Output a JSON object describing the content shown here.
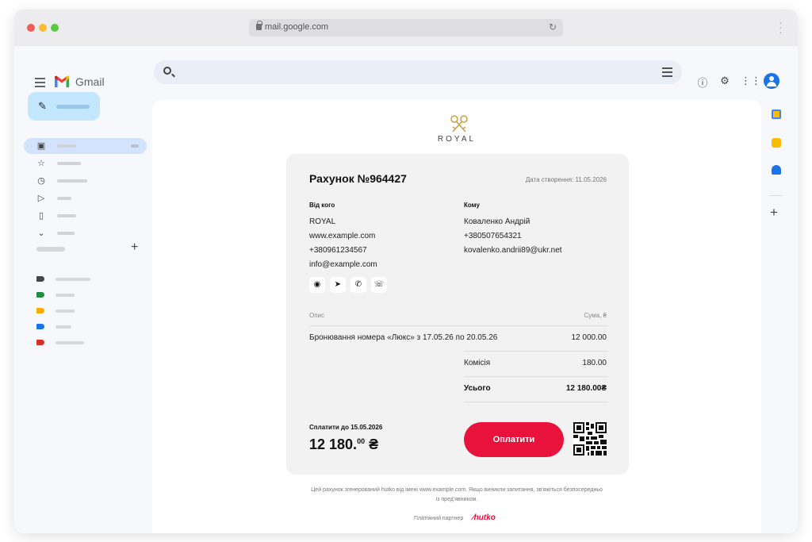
{
  "browser": {
    "url": "mail.google.com"
  },
  "gmail": {
    "app_name": "Gmail"
  },
  "colors": {
    "accent": "#e8123c",
    "compose": "#c2e7ff",
    "nav_active": "#d3e3fd",
    "label_tags": [
      "#444746",
      "#1e8e3e",
      "#f9ab00",
      "#1a73e8",
      "#d93025"
    ]
  },
  "icons": {
    "nav": [
      "inbox-icon",
      "star-icon",
      "clock-icon",
      "send-icon",
      "file-icon",
      "chevron-down-icon"
    ],
    "top": [
      "help-icon",
      "gear-icon",
      "apps-icon"
    ],
    "social": [
      "messenger-icon",
      "telegram-icon",
      "whatsapp-icon",
      "viber-icon"
    ]
  },
  "email": {
    "brand": "ROYAL",
    "invoice": {
      "title": "Рахунок №964427",
      "created": "Дата створення: 11.05.2026",
      "from": {
        "heading": "Від кого",
        "lines": [
          "ROYAL",
          "www.example.com",
          "+380961234567",
          "info@example.com"
        ]
      },
      "to": {
        "heading": "Кому",
        "lines": [
          "Коваленко Андрій",
          "+380507654321",
          "kovalenko.andrii89@ukr.net"
        ]
      },
      "table": {
        "col_desc": "Опис",
        "col_sum": "Сума, ₴",
        "item_desc": "Бронювання номера «Люкс» з 17.05.26 по 20.05.26",
        "item_sum": "12 000.00",
        "fee_label": "Комісія",
        "fee_sum": "180.00",
        "total_label": "Усього",
        "total_sum": "12 180.00₴"
      },
      "due_label": "Сплатити до 15.05.2026",
      "due_int": "12 180.",
      "due_dec": "00",
      "due_currency": "₴",
      "pay_button": "Оплатити"
    },
    "footer": {
      "note": "Цей рахунок згенерований hutko від імені www.example.com. Якщо виникли запитання, зв'яжіться безпосередньо із пред'явником.",
      "partner_label": "Платіжний партнер",
      "partner_name": "hutko"
    }
  }
}
